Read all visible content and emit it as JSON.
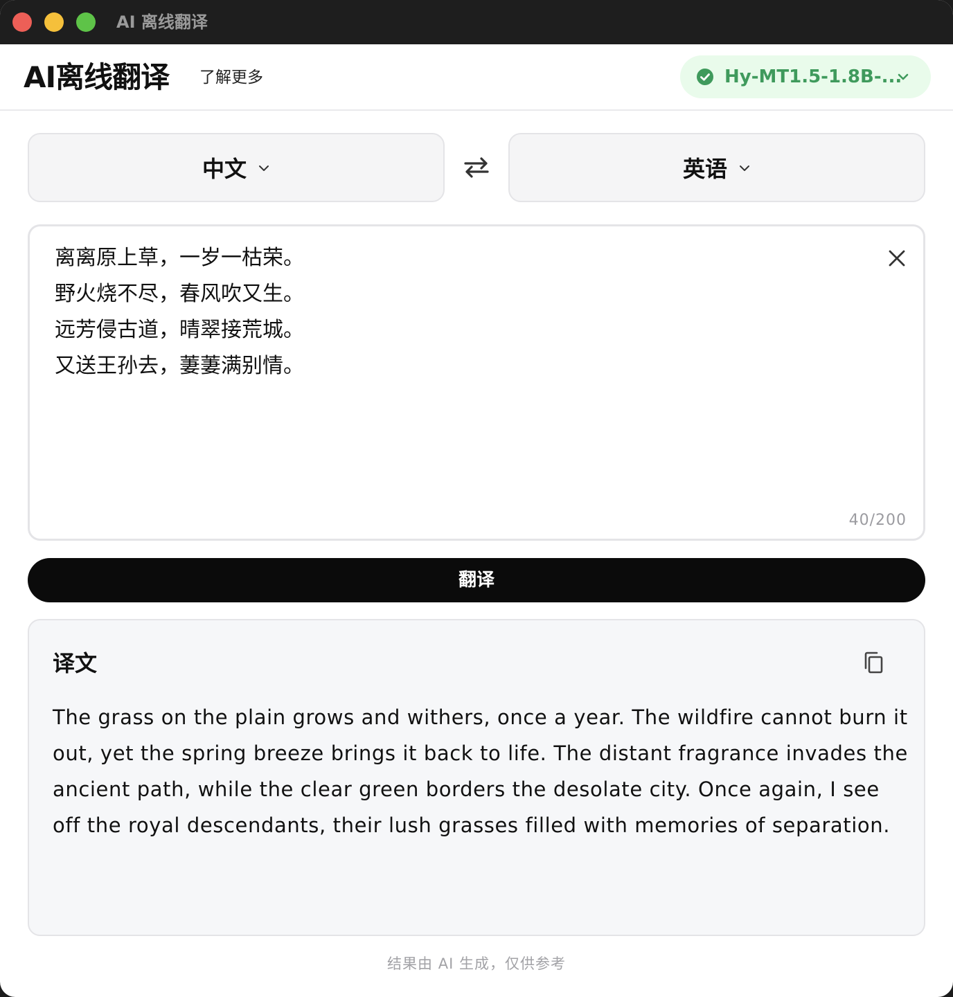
{
  "window": {
    "title": "AI 离线翻译"
  },
  "header": {
    "app_title": "AI离线翻译",
    "learn_more": "了解更多",
    "model": {
      "name": "Hy-MT1.5-1.8B-...",
      "status": "ready",
      "status_color": "#3f9a5c"
    }
  },
  "languages": {
    "source": "中文",
    "target": "英语"
  },
  "input": {
    "text": "离离原上草，一岁一枯荣。\n野火烧不尽，春风吹又生。\n远芳侵古道，晴翠接荒城。\n又送王孙去，萋萋满别情。",
    "char_count": "40/200"
  },
  "actions": {
    "translate_label": "翻译"
  },
  "result": {
    "heading": "译文",
    "text": "The grass on the plain grows and withers, once a year. The wildfire cannot burn it out, yet the spring breeze brings it back to life. The distant fragrance invades the ancient path, while the clear green borders the desolate city. Once again, I see off the royal descendants, their lush grasses filled with memories of separation."
  },
  "footer": {
    "note": "结果由 AI 生成，仅供参考"
  },
  "icons": {
    "model_status": "check-circle-icon",
    "dropdown": "chevron-down-icon",
    "swap": "swap-arrows-icon",
    "clear": "close-icon",
    "copy": "copy-icon"
  }
}
